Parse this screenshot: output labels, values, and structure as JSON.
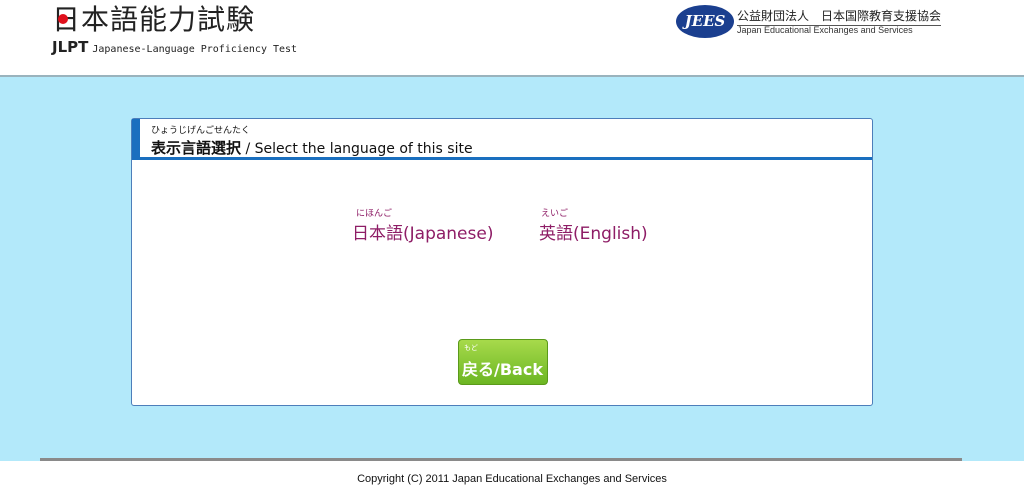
{
  "header": {
    "logo_title": "日本語能力試験",
    "logo_abbr": "JLPT",
    "logo_subtitle": "Japanese-Language Proficiency Test",
    "org_logo": "JEES",
    "org_name_jp": "公益財団法人　日本国際教育支援協会",
    "org_name_en": "Japan Educational Exchanges and Services"
  },
  "panel": {
    "title_ruby": "ひょうじげんごせんたく",
    "title_jp": "表示言語選択",
    "title_en": " / Select the language of this site"
  },
  "languages": [
    {
      "ruby": "にほんご",
      "label": "日本語(Japanese)"
    },
    {
      "ruby": "えいご",
      "label": "英語(English)"
    }
  ],
  "back_button": {
    "ruby": "もど",
    "label": "戻る/Back"
  },
  "footer": {
    "copyright": "Copyright (C) 2011 Japan Educational Exchanges and Services"
  },
  "colors": {
    "background": "#b3e9fa",
    "accent": "#1a6fbf",
    "link": "#8e1d66",
    "button": "#7cc22e"
  }
}
